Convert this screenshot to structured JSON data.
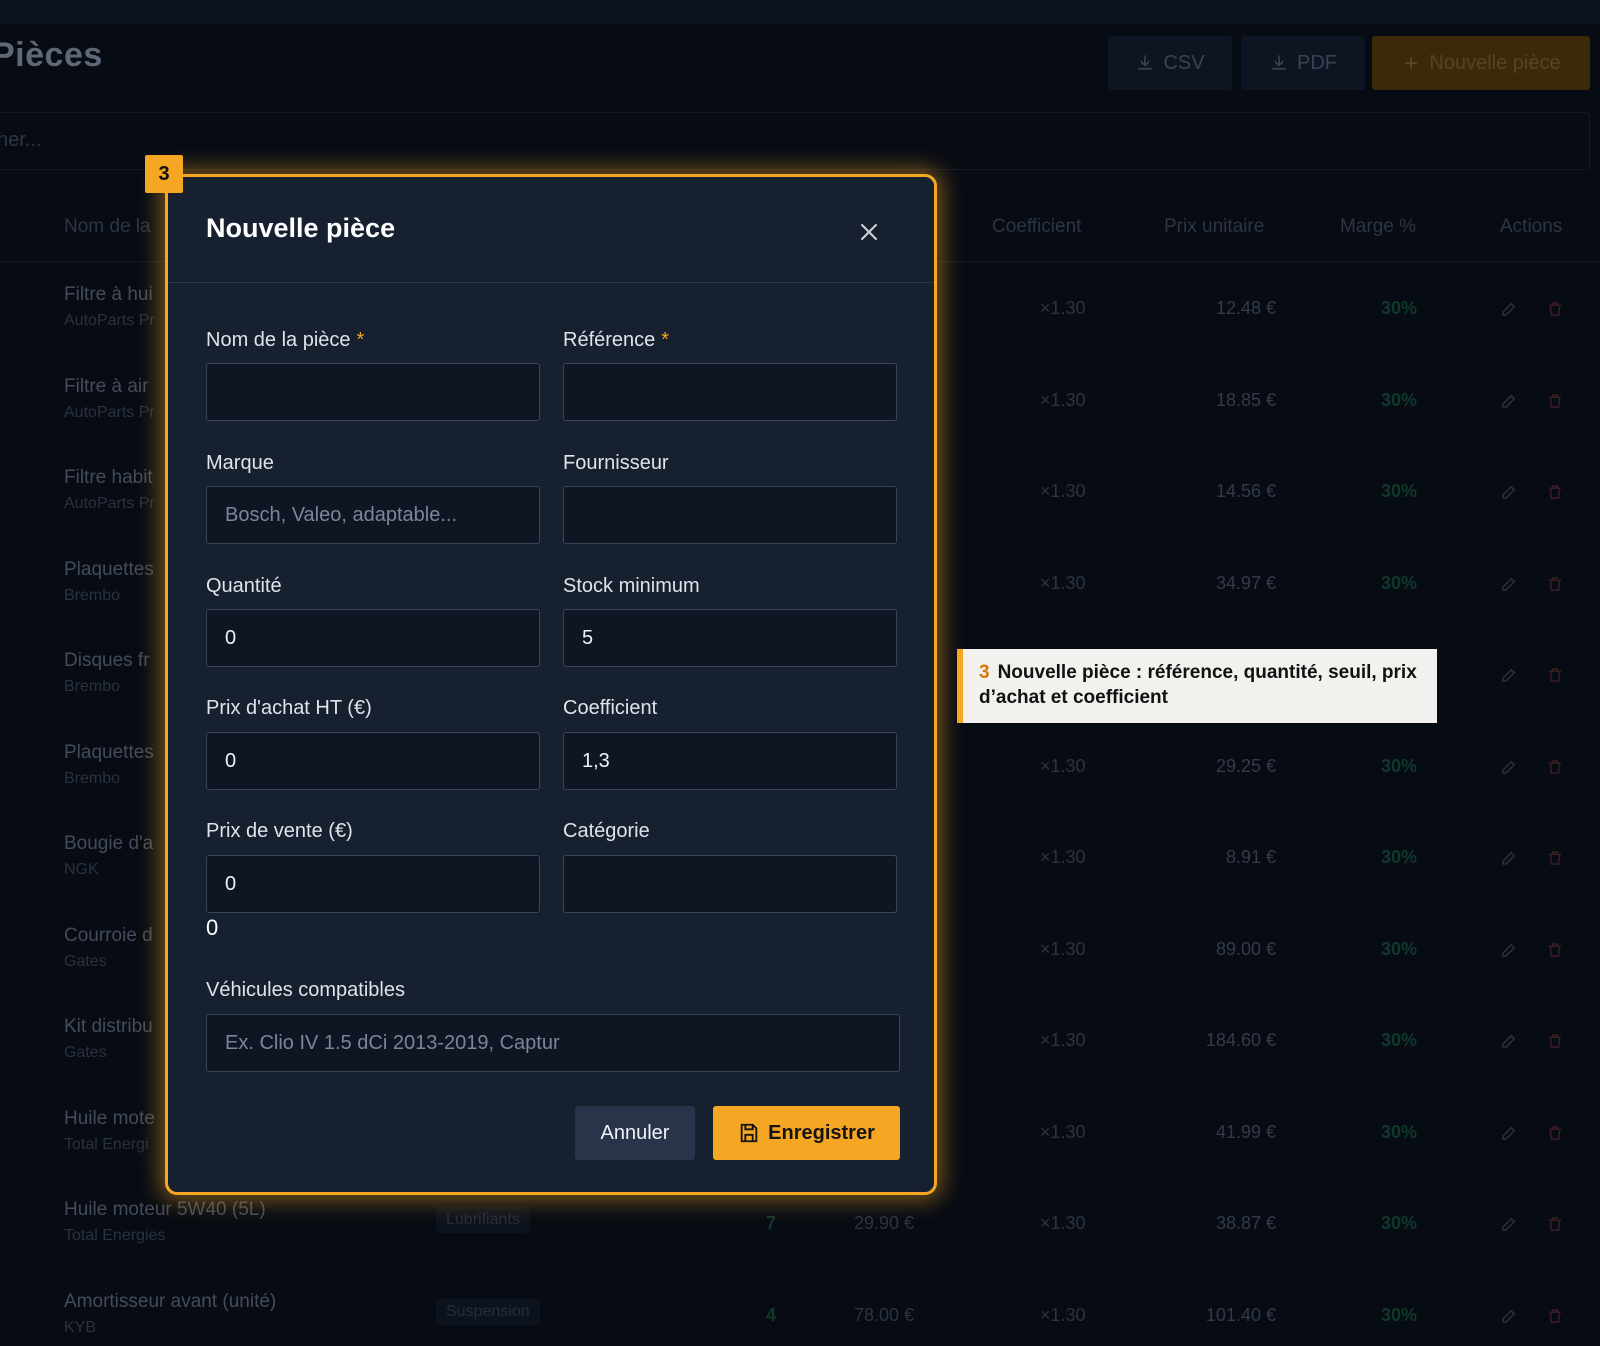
{
  "page": {
    "title": "Pièces",
    "search_placeholder": "her...",
    "buttons": {
      "csv": "CSV",
      "pdf": "PDF",
      "new": "Nouvelle pièce"
    }
  },
  "table": {
    "headers": [
      "Nom de la",
      "Coefficient",
      "Prix unitaire",
      "Marge %",
      "Actions"
    ],
    "rows": [
      {
        "name": "Filtre à hui",
        "brand": "AutoParts Pr",
        "category": "",
        "qty": "",
        "purchase": "",
        "coef": "×1.30",
        "unit": "12.48 €",
        "margin": "30%"
      },
      {
        "name": "Filtre à air",
        "brand": "AutoParts Pr",
        "category": "",
        "qty": "",
        "purchase": "",
        "coef": "×1.30",
        "unit": "18.85 €",
        "margin": "30%"
      },
      {
        "name": "Filtre habit",
        "brand": "AutoParts Pr",
        "category": "",
        "qty": "",
        "purchase": "",
        "coef": "×1.30",
        "unit": "14.56 €",
        "margin": "30%"
      },
      {
        "name": "Plaquettes",
        "brand": "Brembo",
        "category": "",
        "qty": "",
        "purchase": "",
        "coef": "×1.30",
        "unit": "34.97 €",
        "margin": "30%"
      },
      {
        "name": "Disques fr",
        "brand": "Brembo",
        "category": "",
        "qty": "",
        "purchase": "",
        "coef": "",
        "unit": "",
        "margin": ""
      },
      {
        "name": "Plaquettes",
        "brand": "Brembo",
        "category": "",
        "qty": "",
        "purchase": "",
        "coef": "×1.30",
        "unit": "29.25 €",
        "margin": "30%"
      },
      {
        "name": "Bougie d'a",
        "brand": "NGK",
        "category": "",
        "qty": "",
        "purchase": "",
        "coef": "×1.30",
        "unit": "8.91 €",
        "margin": "30%"
      },
      {
        "name": "Courroie d",
        "brand": "Gates",
        "category": "",
        "qty": "",
        "purchase": "",
        "coef": "×1.30",
        "unit": "89.00 €",
        "margin": "30%"
      },
      {
        "name": "Kit distribu",
        "brand": "Gates",
        "category": "",
        "qty": "",
        "purchase": "",
        "coef": "×1.30",
        "unit": "184.60 €",
        "margin": "30%"
      },
      {
        "name": "Huile mote",
        "brand": "Total Energi",
        "category": "",
        "qty": "",
        "purchase": "",
        "coef": "×1.30",
        "unit": "41.99 €",
        "margin": "30%"
      },
      {
        "name": "Huile moteur 5W40 (5L)",
        "brand": "Total Energies",
        "category": "Lubrifiants",
        "qty": "7",
        "purchase": "29.90 €",
        "coef": "×1.30",
        "unit": "38.87 €",
        "margin": "30%"
      },
      {
        "name": "Amortisseur avant (unité)",
        "brand": "KYB",
        "category": "Suspension",
        "qty": "4",
        "purchase": "78.00 €",
        "coef": "×1.30",
        "unit": "101.40 €",
        "margin": "30%"
      }
    ]
  },
  "modal": {
    "title": "Nouvelle pièce",
    "fields": {
      "name": {
        "label": "Nom de la pièce",
        "required": "*",
        "value": ""
      },
      "reference": {
        "label": "Référence",
        "required": "*",
        "value": ""
      },
      "brand": {
        "label": "Marque",
        "placeholder": "Bosch, Valeo, adaptable...",
        "value": ""
      },
      "supplier": {
        "label": "Fournisseur",
        "value": ""
      },
      "quantity": {
        "label": "Quantité",
        "value": "0"
      },
      "stock_min": {
        "label": "Stock minimum",
        "value": "5"
      },
      "purchase_price": {
        "label": "Prix d'achat HT (€)",
        "value": "0"
      },
      "coefficient": {
        "label": "Coefficient",
        "value": "1,3"
      },
      "sale_price": {
        "label": "Prix de vente (€)",
        "value": "0"
      },
      "category": {
        "label": "Catégorie",
        "value": ""
      },
      "vehicles": {
        "label": "Véhicules compatibles",
        "placeholder": "Ex. Clio IV 1.5 dCi 2013-2019, Captur",
        "value": ""
      }
    },
    "computed_sale": "0",
    "cancel_label": "Annuler",
    "save_label": "Enregistrer"
  },
  "annotation": {
    "step": "3",
    "text": "Nouvelle pièce : référence, quantité, seuil, prix d’achat et coefficient"
  },
  "colors": {
    "accent": "#f5a623",
    "modal_bg": "#16202f",
    "page_bg": "#070b13"
  }
}
